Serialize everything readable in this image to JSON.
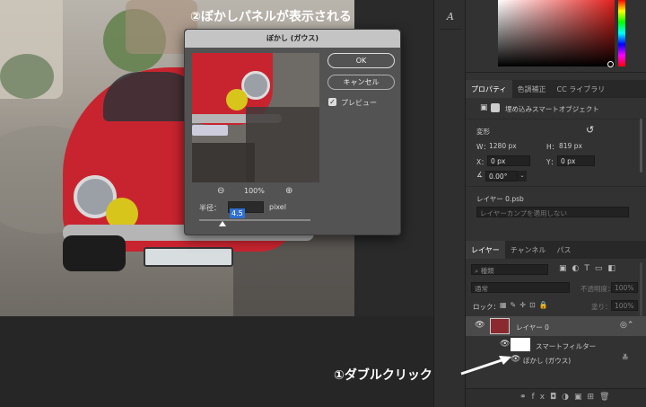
{
  "annotations": {
    "blur_panel_note": "②ぼかしパネルが表示される",
    "double_click_note": "①ダブルクリック"
  },
  "dialog": {
    "title": "ぼかし (ガウス)",
    "ok_label": "OK",
    "cancel_label": "キャンセル",
    "preview_label": "プレビュー",
    "preview_checked": true,
    "zoom_level": "100%",
    "radius_label": "半径：",
    "radius_value": "4.5",
    "radius_unit": "pixel"
  },
  "properties_panel": {
    "tabs": [
      "プロパティ",
      "色調補正",
      "CC ライブラリ"
    ],
    "object_type": "埋め込みスマートオブジェクト",
    "transform_label": "変形",
    "w_label": "W：",
    "w_value": "1280 px",
    "h_label": "H：",
    "h_value": "819 px",
    "x_label": "X：",
    "x_value": "0 px",
    "y_label": "Y：",
    "y_value": "0 px",
    "angle_value": "0.00°",
    "layer_file": "レイヤー 0.psb",
    "layer_comp_placeholder": "レイヤーカンプを適用しない"
  },
  "layers_panel": {
    "tabs": [
      "レイヤー",
      "チャンネル",
      "パス"
    ],
    "filter_kind": "種類",
    "blend_mode": "通常",
    "opacity_label": "不透明度：",
    "opacity_value": "100%",
    "lock_label": "ロック：",
    "fill_label": "塗り：",
    "fill_value": "100%",
    "layers": [
      {
        "name": "レイヤー 0",
        "type": "smart-object"
      },
      {
        "name": "スマートフィルター",
        "type": "smart-filter-mask"
      },
      {
        "name": "ぼかし (ガウス)",
        "type": "filter"
      }
    ]
  },
  "colors": {
    "accent_blue": "#2f6fd1",
    "car_red": "#c8242f",
    "headlight_yellow": "#d8c51c"
  }
}
